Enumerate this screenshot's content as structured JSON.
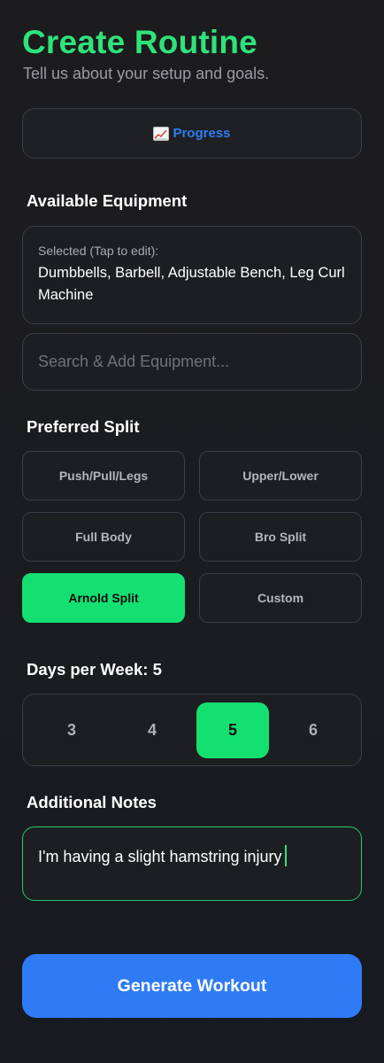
{
  "header": {
    "title": "Create Routine",
    "subtitle": "Tell us about your setup and goals."
  },
  "progress_button": {
    "icon": "chart-increasing-icon",
    "label": "Progress"
  },
  "equipment": {
    "section_label": "Available Equipment",
    "hint": "Selected (Tap to edit):",
    "selected": "Dumbbells, Barbell, Adjustable Bench, Leg Curl Machine",
    "search_placeholder": "Search & Add Equipment..."
  },
  "split": {
    "section_label": "Preferred Split",
    "options": [
      {
        "label": "Push/Pull/Legs",
        "selected": false
      },
      {
        "label": "Upper/Lower",
        "selected": false
      },
      {
        "label": "Full Body",
        "selected": false
      },
      {
        "label": "Bro Split",
        "selected": false
      },
      {
        "label": "Arnold Split",
        "selected": true
      },
      {
        "label": "Custom",
        "selected": false
      }
    ]
  },
  "days": {
    "section_label": "Days per Week: 5",
    "options": [
      "3",
      "4",
      "5",
      "6"
    ],
    "selected": "5"
  },
  "notes": {
    "section_label": "Additional Notes",
    "value": "I'm having a slight hamstring injury"
  },
  "generate_button": {
    "label": "Generate Workout"
  },
  "colors": {
    "accent_green": "#14e072",
    "title_green": "#2fe37a",
    "primary_blue": "#2f7bf6",
    "background": "#1c1c1e",
    "border": "#3a3e4a"
  }
}
